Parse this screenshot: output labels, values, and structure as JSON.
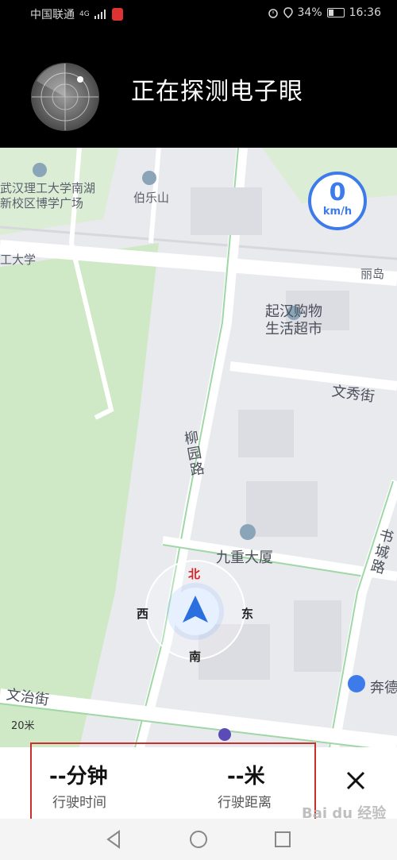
{
  "status_bar": {
    "carrier": "中国联通",
    "network": "4G",
    "battery_percent": "34%",
    "battery_level": 0.34,
    "time": "16:36",
    "icons": [
      "signal-icon",
      "mic-icon",
      "alarm-icon",
      "location-icon",
      "battery-icon"
    ]
  },
  "header": {
    "title": "正在探测电子眼",
    "icon": "radar-icon"
  },
  "map": {
    "speed": {
      "value": "0",
      "unit": "km/h"
    },
    "poi_labels": {
      "school_campus": "武汉理工大学南湖\n新校区博学广场",
      "hill": "伯乐山",
      "university": "工大学",
      "lidao": "丽岛",
      "mall": "起汉购物\n生活超市",
      "wenxiu": "文秀街",
      "liuyuan": "柳园路",
      "jiuzhong": "九重大厦",
      "chengdu": "书城路",
      "wenzhi": "文治街",
      "benchi": "奔德",
      "scale": "20米"
    },
    "compass": {
      "north": "北",
      "south": "南",
      "east": "东",
      "west": "西"
    },
    "colors": {
      "road": "#ffffff",
      "green_area": "#cfe8c6",
      "highway": "#9fd7a6",
      "accent": "#3e7bea"
    }
  },
  "trip": {
    "time_value": "--分钟",
    "time_label": "行驶时间",
    "distance_value": "--米",
    "distance_label": "行驶距离",
    "close_icon": "close-icon"
  },
  "nav_bar": {
    "buttons": [
      "back-icon",
      "home-icon",
      "recents-icon"
    ]
  },
  "watermark": "Bai du 经验"
}
